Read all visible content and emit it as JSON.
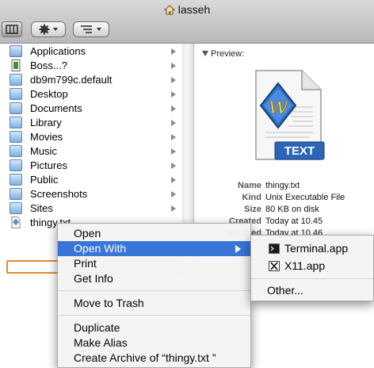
{
  "window": {
    "title": "lasseh"
  },
  "column": {
    "items": [
      {
        "label": "Applications",
        "icon": "applications-folder-icon",
        "has_arrow": true
      },
      {
        "label": "Boss...?",
        "icon": "app-document-icon",
        "has_arrow": true
      },
      {
        "label": "db9m799c.default",
        "icon": "folder-icon",
        "has_arrow": true
      },
      {
        "label": "Desktop",
        "icon": "desktop-folder-icon",
        "has_arrow": true
      },
      {
        "label": "Documents",
        "icon": "documents-folder-icon",
        "has_arrow": true
      },
      {
        "label": "Library",
        "icon": "library-folder-icon",
        "has_arrow": true
      },
      {
        "label": "Movies",
        "icon": "movies-folder-icon",
        "has_arrow": true
      },
      {
        "label": "Music",
        "icon": "music-folder-icon",
        "has_arrow": true
      },
      {
        "label": "Pictures",
        "icon": "pictures-folder-icon",
        "has_arrow": true
      },
      {
        "label": "Public",
        "icon": "public-folder-icon",
        "has_arrow": true
      },
      {
        "label": "Screenshots",
        "icon": "folder-icon",
        "has_arrow": true
      },
      {
        "label": "Sites",
        "icon": "sites-folder-icon",
        "has_arrow": true
      },
      {
        "label": "thingy.txt",
        "icon": "text-file-icon",
        "has_arrow": false,
        "selected": true
      }
    ]
  },
  "preview": {
    "heading": "Preview:",
    "badge": "TEXT",
    "info": [
      {
        "key": "Name",
        "value": "thingy.txt"
      },
      {
        "key": "Kind",
        "value": "Unix Executable File"
      },
      {
        "key": "Size",
        "value": "80 KB on disk"
      },
      {
        "key": "Created",
        "value": "Today at 10.45"
      },
      {
        "key": "Modified",
        "value": "Today at 10.46"
      }
    ]
  },
  "context_menu": {
    "items": [
      {
        "label": "Open"
      },
      {
        "label": "Open With",
        "highlighted": true,
        "submenu": true
      },
      {
        "label": "Print"
      },
      {
        "label": "Get Info"
      },
      {
        "label": "Move to Trash"
      },
      {
        "label": "Duplicate"
      },
      {
        "label": "Make Alias"
      },
      {
        "label": "Create Archive of “thingy.txt ”"
      }
    ]
  },
  "submenu": {
    "apps": [
      {
        "label": "Terminal.app",
        "icon": "terminal-icon"
      },
      {
        "label": "X11.app",
        "icon": "x11-icon"
      }
    ],
    "other": "Other..."
  },
  "colors": {
    "selection_outline": "#e58a2b",
    "menu_highlight": "#3875d7"
  }
}
